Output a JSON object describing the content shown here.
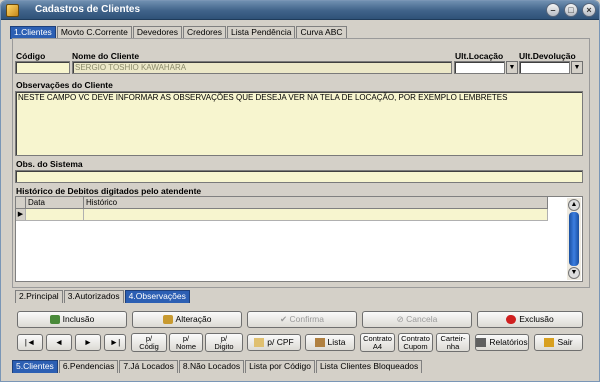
{
  "window": {
    "title": "Cadastros de Clientes"
  },
  "top_tabs": [
    "1.Clientes",
    "Movto C.Corrente",
    "Devedores",
    "Credores",
    "Lista Pendência",
    "Curva ABC"
  ],
  "fields": {
    "codigo_label": "Código",
    "nome_label": "Nome do Cliente",
    "nome_value": "SERGIO TOSHIO KAWAHARA",
    "ult_locacao_label": "Ult.Locação",
    "ult_devolucao_label": "Ult.Devolução",
    "observacoes_label": "Observações do Cliente",
    "observacoes_value": "NESTE CAMPO VC DEVE INFORMAR AS OBSERVAÇÕES QUE DESEJA VER NA TELA DE LOCAÇÃO, POR EXEMPLO LEMBRETES",
    "obs_sistema_label": "Obs. do Sistema",
    "historico_label": "Histórico de Debitos digitados pelo atendente"
  },
  "grid": {
    "columns": [
      "Data",
      "Histórico"
    ]
  },
  "sub_tabs": [
    "2.Principal",
    "3.Autorizados",
    "4.Observações"
  ],
  "buttons": {
    "inclusao": "Inclusão",
    "alteracao": "Alteração",
    "confirma": "Confirma",
    "cancela": "Cancela",
    "exclusao": "Exclusão",
    "first": "|◄",
    "prev": "◄",
    "next": "►",
    "last": "►|",
    "p_codigo": [
      "p/",
      "Códig"
    ],
    "p_nome": [
      "p/",
      "Nome"
    ],
    "p_digito": [
      "p/",
      "Digito"
    ],
    "p_cpf": "p/ CPF",
    "lista": "Lista",
    "contrato_a4": [
      "Contrato",
      "A4"
    ],
    "contrato_cupom": [
      "Contrato",
      "Cupom"
    ],
    "carteirinha": [
      "Carteir-",
      "nha"
    ],
    "relatorios": "Relatórios",
    "sair": "Sair"
  },
  "bottom_tabs": [
    "5.Clientes",
    "6.Pendencias",
    "7.Já Locados",
    "8.Não Locados",
    "Lista por Código",
    "Lista Clientes Bloqueados"
  ],
  "colors": {
    "title_bar": "#3f6289",
    "active_tab": "#2c5fb3",
    "field_yellow": "#f7f5cf",
    "face": "#d4d0c8"
  }
}
